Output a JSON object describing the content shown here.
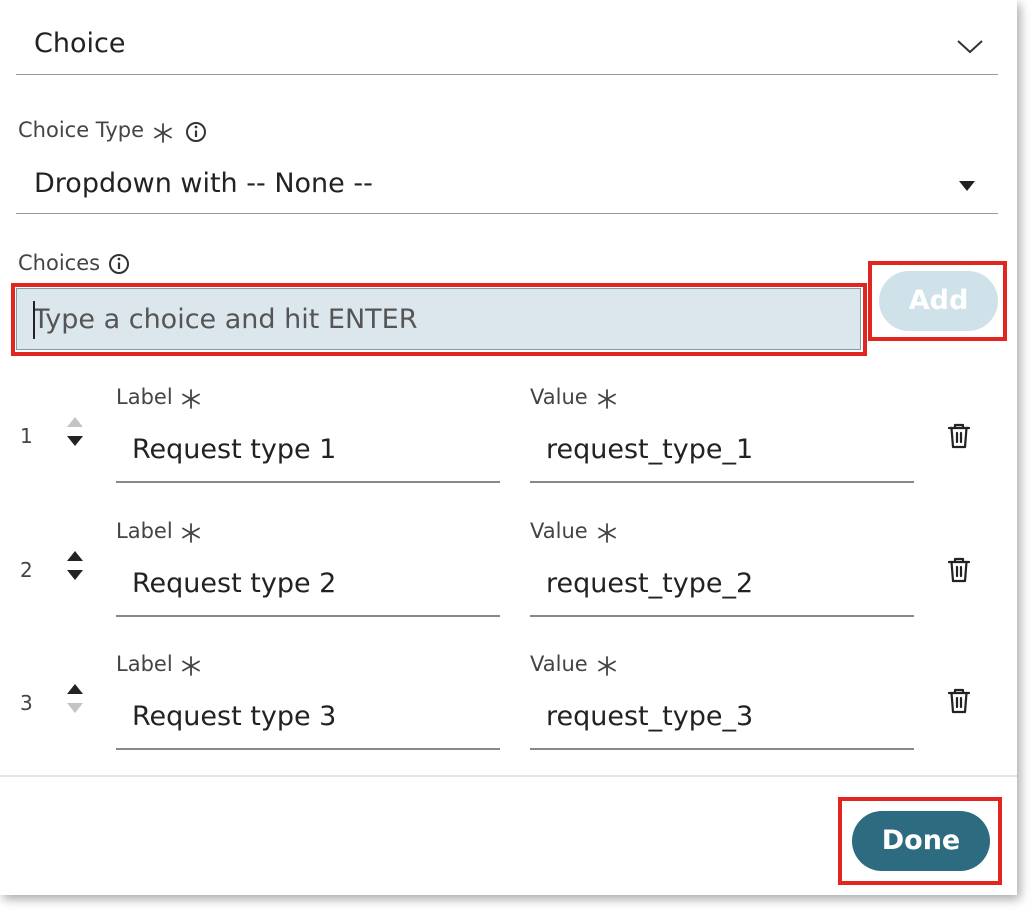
{
  "field_type": {
    "value": "Choice"
  },
  "choice_type": {
    "label": "Choice Type",
    "value": "Dropdown with -- None --"
  },
  "choices": {
    "label": "Choices",
    "input_placeholder": "Type a choice and hit ENTER",
    "add_label": "Add",
    "items": [
      {
        "number": "1",
        "label_caption": "Label",
        "label_value": "Request type 1",
        "value_caption": "Value",
        "value_value": "request_type_1"
      },
      {
        "number": "2",
        "label_caption": "Label",
        "label_value": "Request type 2",
        "value_caption": "Value",
        "value_value": "request_type_2"
      },
      {
        "number": "3",
        "label_caption": "Label",
        "label_value": "Request type 3",
        "value_caption": "Value",
        "value_value": "request_type_3"
      }
    ]
  },
  "footer": {
    "done_label": "Done"
  },
  "colors": {
    "accent": "#2d6b80",
    "add_disabled": "#cfe2e9",
    "input_bg": "#dbe7ec",
    "highlight": "#e0261f"
  },
  "icons": [
    "chevron-down-icon",
    "caret-down-icon",
    "info-icon",
    "asterisk-icon",
    "move-up-icon",
    "move-down-icon",
    "trash-icon"
  ]
}
